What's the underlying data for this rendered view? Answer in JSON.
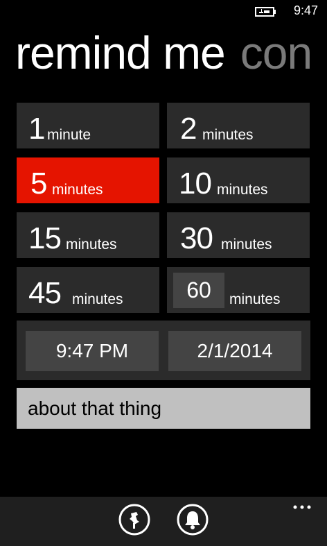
{
  "status": {
    "time": "9:47",
    "icon": "battery-charging-icon"
  },
  "header": {
    "title": "remind me",
    "next_pivot": "con"
  },
  "durations": [
    {
      "number": "1",
      "unit": "minute"
    },
    {
      "number": "2",
      "unit": "minutes"
    },
    {
      "number": "5",
      "unit": "minutes",
      "selected": true
    },
    {
      "number": "10",
      "unit": "minutes"
    },
    {
      "number": "15",
      "unit": "minutes"
    },
    {
      "number": "30",
      "unit": "minutes"
    },
    {
      "number": "45",
      "unit": "minutes"
    },
    {
      "number": "60",
      "unit": "minutes",
      "editable": true
    }
  ],
  "time_picker": {
    "value": "9:47 PM"
  },
  "date_picker": {
    "value": "2/1/2014"
  },
  "note": {
    "value": "about that thing"
  },
  "app_bar": {
    "buttons": [
      {
        "icon": "pin-icon"
      },
      {
        "icon": "bell-icon"
      }
    ],
    "more_icon": "ellipsis-icon"
  },
  "colors": {
    "accent": "#e51400",
    "tile": "#2b2b2b",
    "picker": "#444444",
    "note_background": "#c0c0c0",
    "pivot_inactive": "#7a7a7a"
  }
}
